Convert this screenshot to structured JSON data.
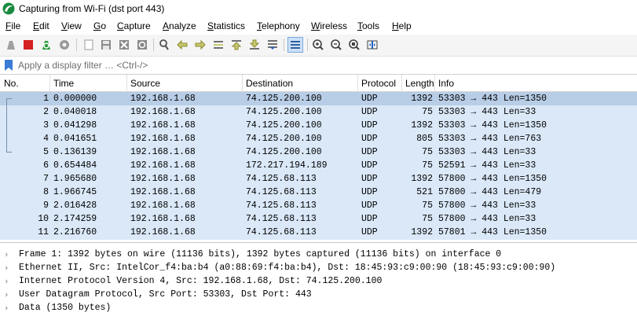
{
  "window": {
    "title": "Capturing from Wi-Fi (dst port 443)"
  },
  "menu": [
    "File",
    "Edit",
    "View",
    "Go",
    "Capture",
    "Analyze",
    "Statistics",
    "Telephony",
    "Wireless",
    "Tools",
    "Help"
  ],
  "filter": {
    "placeholder": "Apply a display filter … <Ctrl-/>"
  },
  "columns": {
    "no": "No.",
    "time": "Time",
    "source": "Source",
    "destination": "Destination",
    "protocol": "Protocol",
    "length": "Length",
    "info": "Info"
  },
  "packets": [
    {
      "no": "1",
      "time": "0.000000",
      "src": "192.168.1.68",
      "dst": "74.125.200.100",
      "proto": "UDP",
      "len": "1392",
      "info": "53303 → 443 Len=1350"
    },
    {
      "no": "2",
      "time": "0.040018",
      "src": "192.168.1.68",
      "dst": "74.125.200.100",
      "proto": "UDP",
      "len": "75",
      "info": "53303 → 443 Len=33"
    },
    {
      "no": "3",
      "time": "0.041298",
      "src": "192.168.1.68",
      "dst": "74.125.200.100",
      "proto": "UDP",
      "len": "1392",
      "info": "53303 → 443 Len=1350"
    },
    {
      "no": "4",
      "time": "0.041651",
      "src": "192.168.1.68",
      "dst": "74.125.200.100",
      "proto": "UDP",
      "len": "805",
      "info": "53303 → 443 Len=763"
    },
    {
      "no": "5",
      "time": "0.136139",
      "src": "192.168.1.68",
      "dst": "74.125.200.100",
      "proto": "UDP",
      "len": "75",
      "info": "53303 → 443 Len=33"
    },
    {
      "no": "6",
      "time": "0.654484",
      "src": "192.168.1.68",
      "dst": "172.217.194.189",
      "proto": "UDP",
      "len": "75",
      "info": "52591 → 443 Len=33"
    },
    {
      "no": "7",
      "time": "1.965680",
      "src": "192.168.1.68",
      "dst": "74.125.68.113",
      "proto": "UDP",
      "len": "1392",
      "info": "57800 → 443 Len=1350"
    },
    {
      "no": "8",
      "time": "1.966745",
      "src": "192.168.1.68",
      "dst": "74.125.68.113",
      "proto": "UDP",
      "len": "521",
      "info": "57800 → 443 Len=479"
    },
    {
      "no": "9",
      "time": "2.016428",
      "src": "192.168.1.68",
      "dst": "74.125.68.113",
      "proto": "UDP",
      "len": "75",
      "info": "57800 → 443 Len=33"
    },
    {
      "no": "10",
      "time": "2.174259",
      "src": "192.168.1.68",
      "dst": "74.125.68.113",
      "proto": "UDP",
      "len": "75",
      "info": "57800 → 443 Len=33"
    },
    {
      "no": "11",
      "time": "2.216760",
      "src": "192.168.1.68",
      "dst": "74.125.68.113",
      "proto": "UDP",
      "len": "1392",
      "info": "57801 → 443 Len=1350"
    }
  ],
  "details": [
    "Frame 1: 1392 bytes on wire (11136 bits), 1392 bytes captured (11136 bits) on interface 0",
    "Ethernet II, Src: IntelCor_f4:ba:b4 (a0:88:69:f4:ba:b4), Dst: 18:45:93:c9:00:90 (18:45:93:c9:00:90)",
    "Internet Protocol Version 4, Src: 192.168.1.68, Dst: 74.125.200.100",
    "User Datagram Protocol, Src Port: 53303, Dst Port: 443",
    "Data (1350 bytes)"
  ],
  "colors": {
    "row_udp": "#dae8f8",
    "row_selected": "#b8cde6",
    "accent": "#3a7bd5"
  }
}
